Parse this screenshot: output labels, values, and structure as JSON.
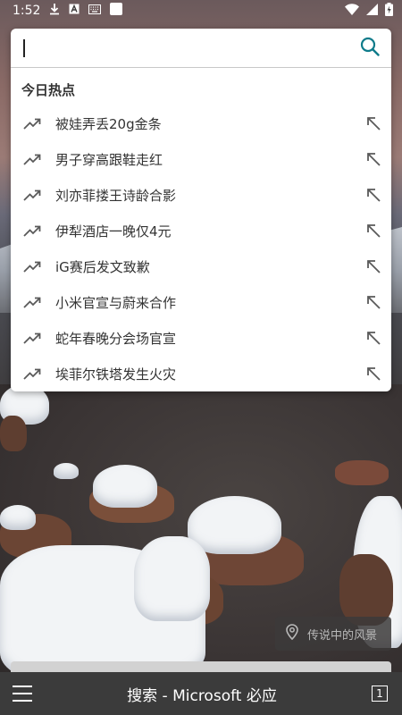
{
  "status_bar": {
    "time": "1:52",
    "icons": [
      "download-icon",
      "font-icon",
      "keyboard-icon",
      "square-icon",
      "wifi-icon",
      "signal-icon",
      "battery-icon"
    ]
  },
  "search": {
    "placeholder": "",
    "value": ""
  },
  "trending": {
    "title": "今日热点",
    "items": [
      {
        "label": "被娃弄丢20g金条"
      },
      {
        "label": "男子穿高跟鞋走红"
      },
      {
        "label": "刘亦菲搂王诗龄合影"
      },
      {
        "label": "伊犁酒店一晚仅4元"
      },
      {
        "label": "iG赛后发文致歉"
      },
      {
        "label": "小米官宣与蔚来合作"
      },
      {
        "label": "蛇年春晚分会场官宣"
      },
      {
        "label": "埃菲尔铁塔发生火灾"
      }
    ]
  },
  "location": {
    "label": "传说中的风景"
  },
  "bottom_bar": {
    "title": "搜索 - Microsoft 必应",
    "tab_count": "1"
  },
  "colors": {
    "accent": "#0f7b8a",
    "icon_gray": "#5a5a5a"
  }
}
